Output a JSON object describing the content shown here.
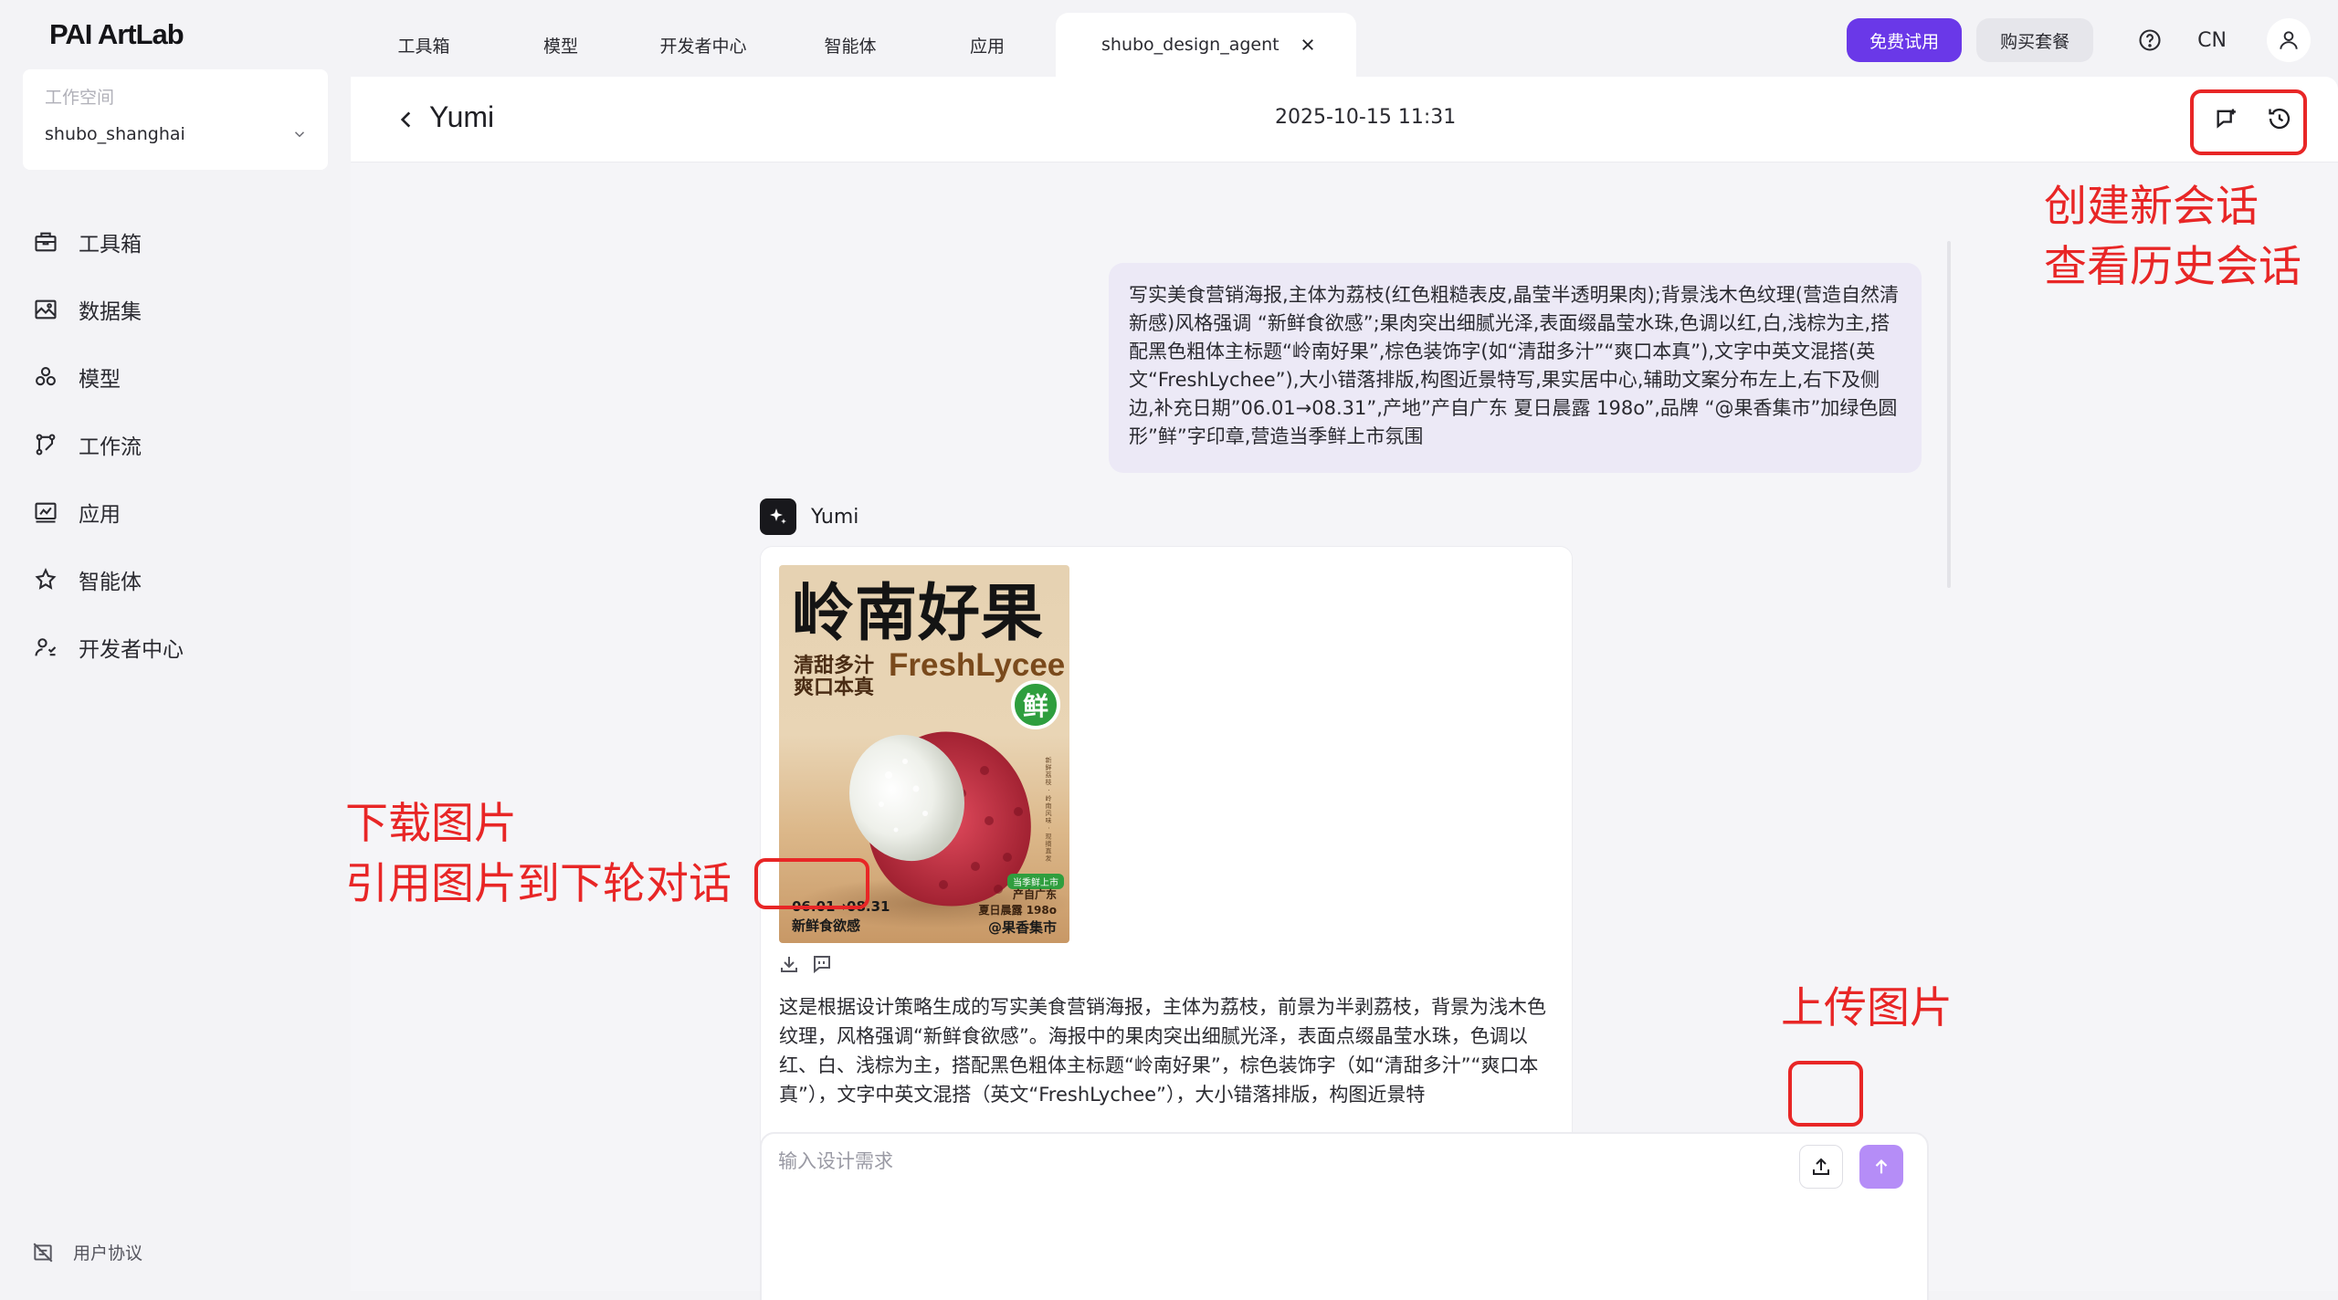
{
  "app": {
    "logo": "PAI ArtLab"
  },
  "workspace": {
    "label": "工作空间",
    "name": "shubo_shanghai"
  },
  "sidebar": {
    "items": [
      {
        "label": "工具箱",
        "icon": "toolbox-icon"
      },
      {
        "label": "数据集",
        "icon": "dataset-icon"
      },
      {
        "label": "模型",
        "icon": "model-icon"
      },
      {
        "label": "工作流",
        "icon": "workflow-icon"
      },
      {
        "label": "应用",
        "icon": "app-icon"
      },
      {
        "label": "智能体",
        "icon": "agent-icon"
      },
      {
        "label": "开发者中心",
        "icon": "developer-icon"
      }
    ],
    "footer": "用户协议"
  },
  "tabs": [
    {
      "label": "工具箱"
    },
    {
      "label": "模型"
    },
    {
      "label": "开发者中心"
    },
    {
      "label": "智能体"
    },
    {
      "label": "应用"
    },
    {
      "label": "shubo_design_agent",
      "active": true
    }
  ],
  "top_actions": {
    "free_trial": "免费试用",
    "buy": "购买套餐",
    "lang": "CN"
  },
  "chat": {
    "title": "Yumi",
    "timestamp": "2025-10-15 11:31",
    "user_message": "写实美食营销海报,主体为荔枝(红色粗糙表皮,晶莹半透明果肉);背景浅木色纹理(营造自然清新感)风格强调 “新鲜食欲感”;果肉突出细腻光泽,表面缀晶莹水珠,色调以红,白,浅棕为主,搭配黑色粗体主标题“岭南好果”,棕色装饰字(如“清甜多汁”“爽口本真”),文字中英文混搭(英文“FreshLychee”),大小错落排版,构图近景特写,果实居中心,辅助文案分布左上,右下及侧边,补充日期”06.01→08.31”,产地”产自广东 夏日晨露 198o”,品牌 “@果香集市”加绿色圆形”鲜”字印章,营造当季鲜上市氛围",
    "bot_name": "Yumi",
    "bot_text": "这是根据设计策略生成的写实美食营销海报，主体为荔枝，前景为半剥荔枝，背景为浅木色纹理，风格强调“新鲜食欲感”。海报中的果肉突出细腻光泽，表面点缀晶莹水珠，色调以红、白、浅棕为主，搭配黑色粗体主标题“岭南好果”，棕色装饰字（如“清甜多汁”“爽口本真”），文字中英文混搭（英文“FreshLychee”），大小错落排版，构图近景特"
  },
  "poster": {
    "title": "岭南好果",
    "sub1": "清甜多汁",
    "sub2": "爽口本真",
    "en": "FreshLycee",
    "badge": "鲜",
    "date": "06.01→08.31",
    "date_caption": "新鲜食欲感",
    "tag": "当季鲜上市",
    "origin1": "产自广东",
    "origin2": "夏日晨露 198o",
    "brand": "@果香集市",
    "side_text": "新鲜荔枝 · 岭南风味 · 现摘直发"
  },
  "input": {
    "placeholder": "输入设计需求"
  },
  "annotations": {
    "new_chat": "创建新会话",
    "history": "查看历史会话",
    "download": "下载图片",
    "reference": "引用图片到下轮对话",
    "upload": "上传图片"
  },
  "colors": {
    "accent": "#6a38e8",
    "send": "#b58df7",
    "annotation": "#e82626",
    "badge": "#2f9e3e"
  }
}
